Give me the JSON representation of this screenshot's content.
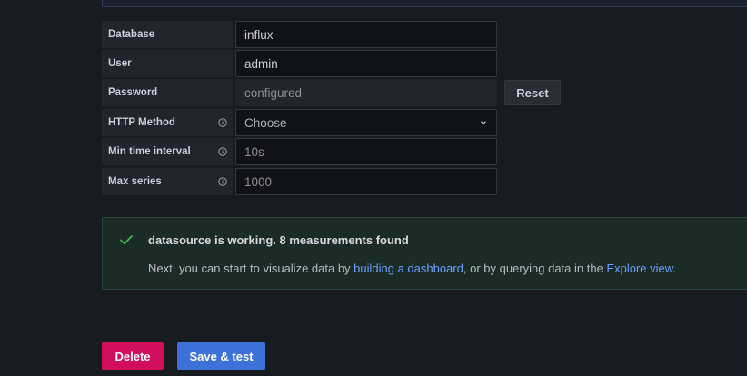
{
  "form": {
    "rows": [
      {
        "label": "Database",
        "value": "influx",
        "info": false
      },
      {
        "label": "User",
        "value": "admin",
        "info": false
      },
      {
        "label": "Password",
        "value": "configured",
        "info": false
      },
      {
        "label": "HTTP Method",
        "value": "Choose",
        "info": true
      },
      {
        "label": "Min time interval",
        "placeholder": "10s",
        "info": true
      },
      {
        "label": "Max series",
        "placeholder": "1000",
        "info": true
      }
    ],
    "reset_label": "Reset",
    "info_icon": "info-circle-icon",
    "select_icon": "chevron-down-icon"
  },
  "alert": {
    "icon": "check-icon",
    "title": "datasource is working. 8 measurements found",
    "body_prefix": "Next, you can start to visualize data by ",
    "link_dashboard": "building a dashboard",
    "body_middle": ", or by querying data in the ",
    "link_explore": "Explore view",
    "body_suffix": "."
  },
  "actions": {
    "delete_label": "Delete",
    "save_label": "Save & test"
  },
  "colors": {
    "background": "#181b1f",
    "success": "#1a7f4b",
    "link": "#6e9fff",
    "danger": "#d10e5c",
    "primary": "#3d71d9"
  }
}
